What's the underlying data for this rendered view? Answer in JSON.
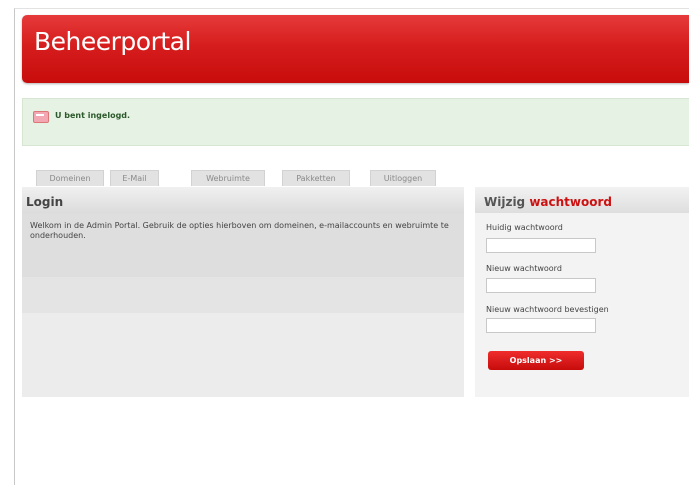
{
  "header": {
    "title": "Beheerportal"
  },
  "notice": {
    "text": "U bent ingelogd."
  },
  "tabs": [
    {
      "label": "Domeinen"
    },
    {
      "label": "E-Mail"
    },
    {
      "label": "Webruimte"
    },
    {
      "label": "Pakketten"
    },
    {
      "label": "Uitloggen"
    }
  ],
  "login_panel": {
    "title": "Login",
    "text": "Welkom in de Admin Portal. Gebruik de opties hierboven om domeinen, e-mailaccounts en webruimte te onderhouden."
  },
  "password_panel": {
    "title_prefix": "Wijzig ",
    "title_accent": "wachtwoord",
    "current_label": "Huidig wachtwoord",
    "current_value": "",
    "new_label": "Nieuw wachtwoord",
    "new_value": "",
    "confirm_label": "Nieuw wachtwoord bevestigen",
    "confirm_value": "",
    "save_button": "Opslaan >>"
  },
  "colors": {
    "brand_red": "#d61d1d",
    "accent_red": "#cc1111",
    "notice_bg": "#e6f2e3"
  },
  "icons": {
    "notice_icon": "message-icon"
  }
}
